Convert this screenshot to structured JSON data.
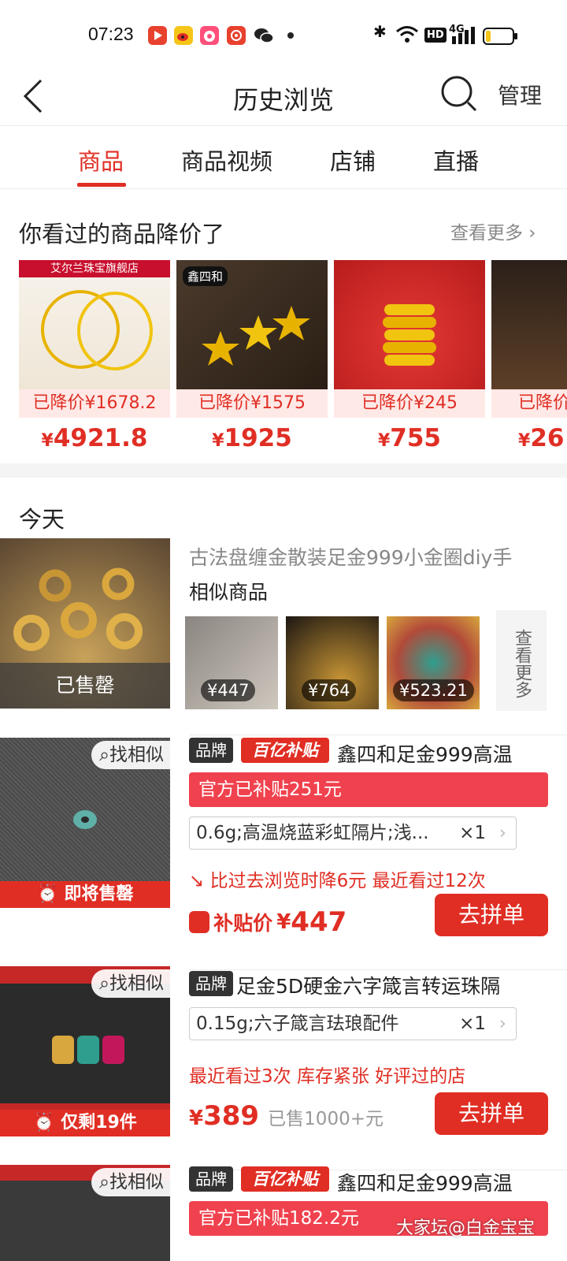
{
  "status_bar": {
    "time": "07:23",
    "bluetooth": "✱",
    "hd": "HD",
    "signal": "4G",
    "battery": "battery-low"
  },
  "header": {
    "title": "历史浏览",
    "manage": "管理"
  },
  "tabs": [
    {
      "label": "商品",
      "active": true
    },
    {
      "label": "商品视频"
    },
    {
      "label": "店铺"
    },
    {
      "label": "直播"
    }
  ],
  "price_drop": {
    "title": "你看过的商品降价了",
    "more": "查看更多",
    "cards": [
      {
        "banner": "艾尔兰珠宝旗舰店",
        "drop": "已降价¥1678.2",
        "currency": "¥",
        "price": "4921.8"
      },
      {
        "banner": "鑫四和",
        "drop": "已降价¥1575",
        "currency": "¥",
        "price": "1925"
      },
      {
        "banner": "",
        "drop": "已降价¥245",
        "currency": "¥",
        "price": "755"
      },
      {
        "banner": "",
        "drop": "已降价",
        "currency": "¥",
        "price": "26"
      }
    ]
  },
  "section": {
    "today": "今天"
  },
  "item1": {
    "title": "古法盘缠金散装足金999小金圈diy手",
    "status": "已售罄",
    "similar_label": "相似商品",
    "similar": [
      {
        "price": "¥447"
      },
      {
        "price": "¥764"
      },
      {
        "price": "¥523.21"
      }
    ],
    "more": "查看更多"
  },
  "item2": {
    "find_similar": "找相似",
    "alert": "即将售罄",
    "brand": "品牌",
    "subsidy_logo": "百亿补贴",
    "title": "鑫四和足金999高温",
    "official": "官方已补贴251元",
    "spec": "0.6g;高温烧蓝彩虹隔片;浅...",
    "qty": "×1",
    "note": "比过去浏览时降6元  最近看过12次",
    "price_label": "补贴价",
    "currency": "¥",
    "price": "447",
    "button": "去拼单"
  },
  "item3": {
    "find_similar": "找相似",
    "alert": "仅剩19件",
    "brand": "品牌",
    "title": "足金5D硬金六字箴言转运珠隔",
    "spec": "0.15g;六子箴言珐琅配件",
    "qty": "×1",
    "note": "最近看过3次  库存紧张  好评过的店",
    "currency": "¥",
    "price": "389",
    "sold": "已售1000+元",
    "button": "去拼单"
  },
  "item4": {
    "find_similar": "找相似",
    "brand": "品牌",
    "subsidy_logo": "百亿补贴",
    "title": "鑫四和足金999高温",
    "official": "官方已补贴182.2元"
  },
  "watermark": "大家坛@白金宝宝"
}
